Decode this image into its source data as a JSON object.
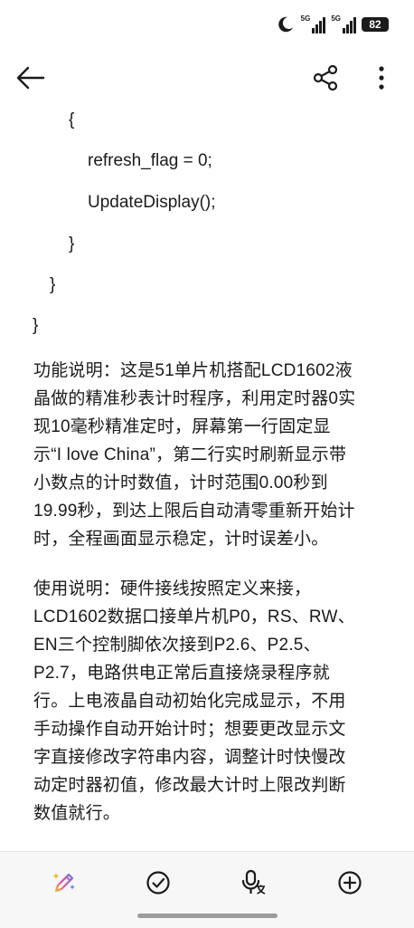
{
  "status_bar": {
    "signal1_label": "5G",
    "signal2_label": "5G",
    "battery": "82"
  },
  "app_bar": {
    "back_icon": "arrow-left-icon",
    "share_icon": "share-icon",
    "more_icon": "more-vertical-icon"
  },
  "code_lines": [
    "{",
    "refresh_flag = 0;",
    "UpdateDisplay();",
    "}",
    "}",
    "}"
  ],
  "paragraphs": [
    {
      "lines": [
        "功能说明：这是51单片机搭配LCD1602液",
        "晶做的精准秒表计时程序，利用定时器0实",
        "现10毫秒精准定时，屏幕第一行固定显",
        "示“I love China”，第二行实时刷新显示带",
        "小数点的计时数值，计时范围0.00秒到",
        "19.99秒，到达上限后自动清零重新开始计",
        "时，全程画面显示稳定，计时误差小。"
      ]
    },
    {
      "lines": [
        "使用说明：硬件接线按照定义来接，",
        "LCD1602数据口接单片机P0，RS、RW、",
        "EN三个控制脚依次接到P2.6、P2.5、",
        "P2.7，电路供电正常后直接烧录程序就",
        "行。上电液晶自动初始化完成显示，不用",
        "手动操作自动开始计时；想要更改显示文",
        "字直接修改字符串内容，调整计时快慢改",
        "动定时器初值，修改最大计时上限改判断",
        "数值就行。"
      ]
    }
  ],
  "bottom_toolbar": {
    "items": [
      "magic-pen-icon",
      "check-circle-icon",
      "voice-input-icon",
      "add-circle-icon"
    ]
  }
}
